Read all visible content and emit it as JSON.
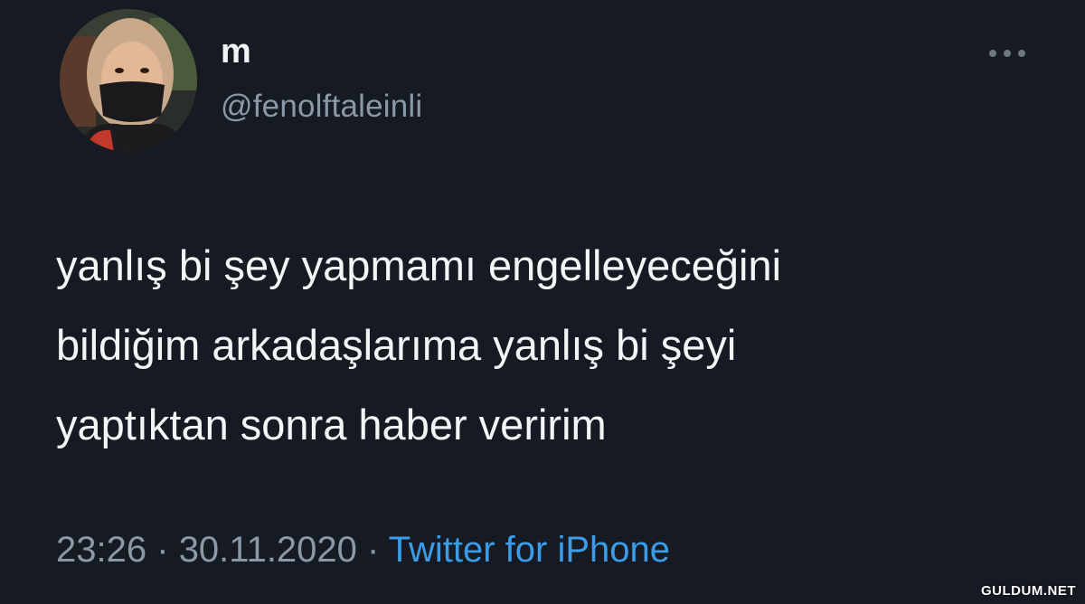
{
  "tweet": {
    "display_name": "m",
    "handle": "@fenolftaleinli",
    "text_lines": [
      "yanlış bi şey yapmamı engelleyeceğini",
      "bildiğim arkadaşlarıma yanlış bi şeyi",
      "yaptıktan sonra haber veririm"
    ],
    "time": "23:26",
    "separator": "·",
    "date": "30.11.2020",
    "source": "Twitter for iPhone"
  },
  "icons": {
    "more": "more-horizontal-icon",
    "avatar": "profile-photo"
  },
  "colors": {
    "background": "#151a23",
    "text": "#f3f5f7",
    "muted": "#8b98a5",
    "link": "#3d9ce6"
  },
  "watermark": "GULDUM.NET"
}
